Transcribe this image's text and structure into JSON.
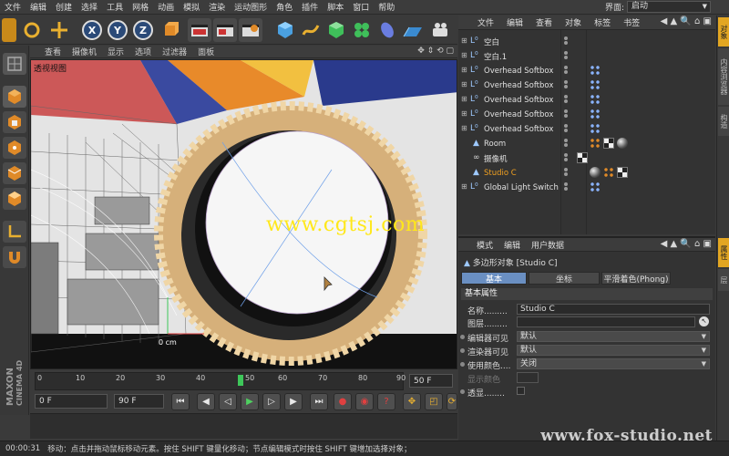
{
  "menubar": {
    "items": [
      "文件",
      "编辑",
      "创建",
      "选择",
      "工具",
      "网格",
      "动画",
      "模拟",
      "渲染",
      "运动图形",
      "角色",
      "插件",
      "脚本",
      "窗口",
      "帮助"
    ],
    "layout_label": "界面:",
    "layout_value": "启动"
  },
  "toolbar": {
    "axis_x": "X",
    "axis_y": "Y",
    "axis_z": "Z"
  },
  "viewport": {
    "menu": [
      "查看",
      "摄像机",
      "显示",
      "选项",
      "过滤器",
      "面板"
    ],
    "label": "透视视图",
    "watermark": "www.cgtsj.com",
    "scale_label": "0 cm"
  },
  "timeline": {
    "ticks": [
      "0",
      "10",
      "20",
      "30",
      "40",
      "50",
      "60",
      "70",
      "80",
      "90"
    ],
    "current_frame": "50",
    "end_frame": "50 F",
    "start_field": "0 F",
    "end_field": "90 F"
  },
  "object_manager": {
    "menu": [
      "文件",
      "编辑",
      "查看",
      "对象",
      "标签",
      "书签"
    ],
    "objects": [
      {
        "name": "空白",
        "icon": "null-icon"
      },
      {
        "name": "空白.1",
        "icon": "null-icon"
      },
      {
        "name": "Overhead Softbox",
        "icon": "null-icon"
      },
      {
        "name": "Overhead Softbox",
        "icon": "null-icon"
      },
      {
        "name": "Overhead Softbox",
        "icon": "null-icon"
      },
      {
        "name": "Overhead Softbox",
        "icon": "null-icon"
      },
      {
        "name": "Overhead Softbox",
        "icon": "null-icon"
      },
      {
        "name": "Room",
        "icon": "polygon-icon"
      },
      {
        "name": "摄像机",
        "icon": "camera-icon"
      },
      {
        "name": "Studio C",
        "icon": "polygon-icon"
      },
      {
        "name": "Global Light Switch",
        "icon": "null-icon"
      }
    ]
  },
  "attribute_manager": {
    "menu": [
      "模式",
      "编辑",
      "用户数据"
    ],
    "title": "多边形对象 [Studio C]",
    "tabs": [
      "基本",
      "坐标",
      "平滑着色(Phong)"
    ],
    "section": "基本属性",
    "fields": {
      "name_label": "名称.........",
      "name_value": "Studio C",
      "layer_label": "图层.........",
      "editor_vis_label": "编辑器可见",
      "editor_vis_value": "默认",
      "render_vis_label": "渲染器可见",
      "render_vis_value": "默认",
      "use_color_label": "使用颜色....",
      "use_color_value": "关闭",
      "display_color_label": "显示颜色",
      "xray_label": "透显........"
    }
  },
  "side_tabs": {
    "top": [
      "对象",
      "内容浏览器",
      "构造"
    ],
    "bottom": [
      "属性",
      "层"
    ]
  },
  "statusbar": {
    "time": "00:00:31",
    "message": "移动：点击并拖动鼠标移动元素。按住 SHIFT 键量化移动；节点编辑模式时按住 SHIFT 键增加选择对象；"
  },
  "branding": {
    "vendor": "MAXON",
    "product": "CINEMA 4D",
    "site": "www.fox-studio.net"
  },
  "colors": {
    "accent": "#e2a622",
    "selected_text": "#f0a020",
    "tab_active": "#6a8fc2",
    "playhead": "#3ec75a"
  }
}
